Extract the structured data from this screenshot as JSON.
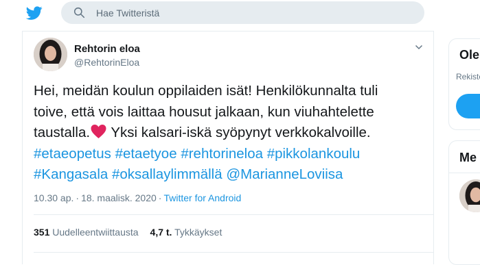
{
  "search": {
    "placeholder": "Hae Twitteristä"
  },
  "tweet": {
    "author_name": "Rehtorin eloa",
    "author_handle": "@RehtorinEloa",
    "line1": "Hei, meidän koulun oppilaiden isät! Henkilökunnalta tuli",
    "line2": "toive, että vois laittaa housut jalkaan, kun viuhahtelette",
    "line3_before": "taustalla.",
    "line3_after": " Yksi kalsari-iskä syöpynyt verkkokalvoille.",
    "hashtags": [
      "#etaeopetus",
      "#etaetyoe",
      "#rehtorineloa",
      "#pikkolankoulu",
      "#Kangasala",
      "#oksallaylimmällä"
    ],
    "mention": "@MarianneLoviisa",
    "time": "10.30 ap.",
    "date": "18. maalisk. 2020",
    "source": "Twitter for Android",
    "retweets_count": "351",
    "retweets_label": "Uudelleentwiittausta",
    "likes_count": "4,7 t.",
    "likes_label": "Tykkäykset"
  },
  "sidebar": {
    "card1_title": "Ole",
    "card1_sub": "Rekiste",
    "card2_title": "Me"
  },
  "colors": {
    "brand": "#1da1f2",
    "link": "#1b95e0",
    "heart": "#e0245e"
  },
  "icons": [
    "twitter-bird-icon",
    "search-icon",
    "chevron-down-icon",
    "heart-emoji"
  ]
}
